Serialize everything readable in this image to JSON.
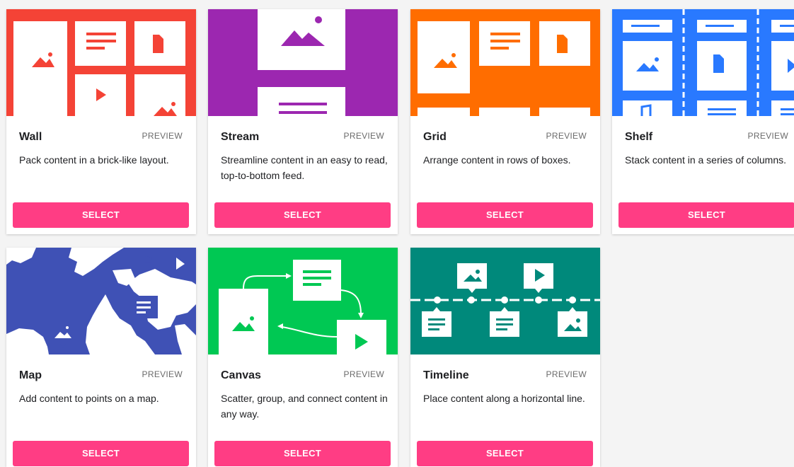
{
  "colors": {
    "select_button": "#ff3d84",
    "wall": "#f44336",
    "stream": "#9c27b0",
    "grid": "#ff6d00",
    "shelf": "#2979ff",
    "map": "#3f51b5",
    "canvas": "#00c853",
    "timeline": "#00897b"
  },
  "layouts": [
    {
      "id": "wall",
      "title": "Wall",
      "preview": "PREVIEW",
      "description": "Pack content in a brick-like layout.",
      "select": "SELECT"
    },
    {
      "id": "stream",
      "title": "Stream",
      "preview": "PREVIEW",
      "description": "Streamline content in an easy to read, top-to-bottom feed.",
      "select": "SELECT"
    },
    {
      "id": "grid",
      "title": "Grid",
      "preview": "PREVIEW",
      "description": "Arrange content in rows of boxes.",
      "select": "SELECT"
    },
    {
      "id": "shelf",
      "title": "Shelf",
      "preview": "PREVIEW",
      "description": "Stack content in a series of columns.",
      "select": "SELECT"
    },
    {
      "id": "map",
      "title": "Map",
      "preview": "PREVIEW",
      "description": "Add content to points on a map.",
      "select": "SELECT"
    },
    {
      "id": "canvas",
      "title": "Canvas",
      "preview": "PREVIEW",
      "description": "Scatter, group, and connect content in any way.",
      "select": "SELECT"
    },
    {
      "id": "timeline",
      "title": "Timeline",
      "preview": "PREVIEW",
      "description": "Place content along a horizontal line.",
      "select": "SELECT"
    }
  ]
}
